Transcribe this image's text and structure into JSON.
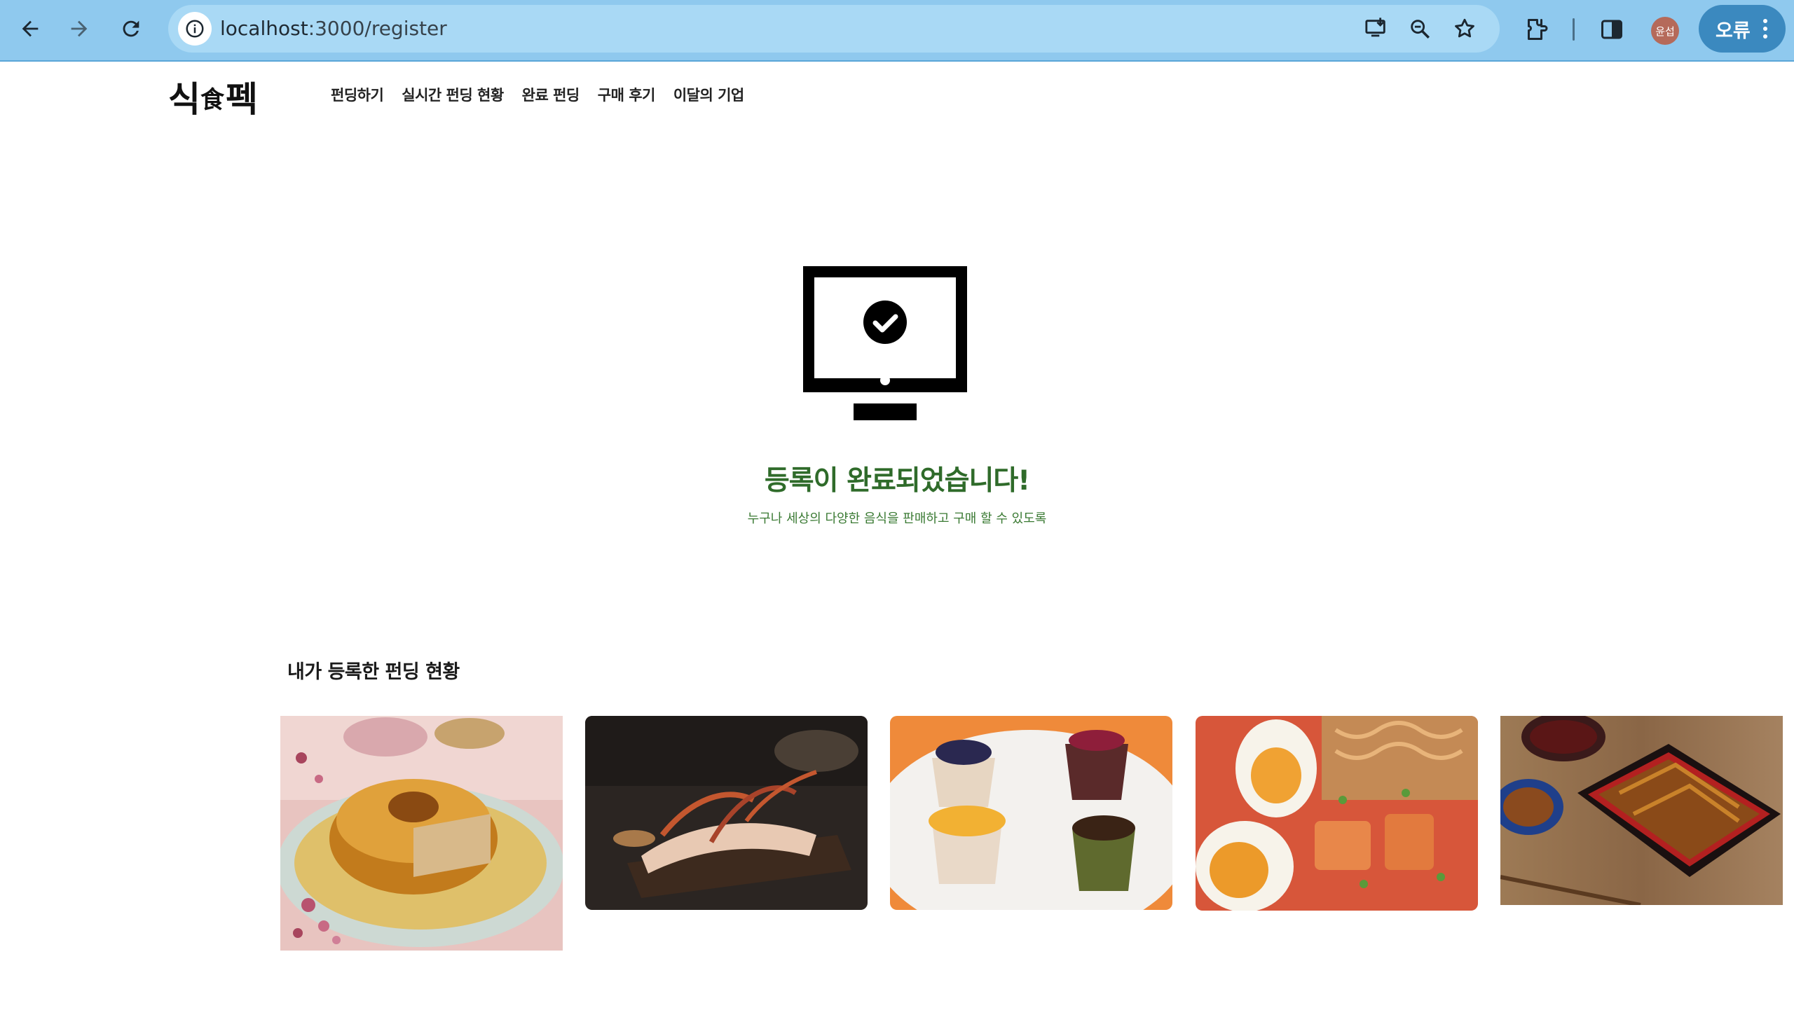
{
  "browser": {
    "url_host": "localhost",
    "url_path": ":3000/register",
    "profile_initials": "윤섭",
    "error_label": "오류",
    "icons": [
      "back-arrow-icon",
      "forward-arrow-icon",
      "reload-icon",
      "site-info-icon",
      "install-app-icon",
      "zoom-icon",
      "bookmark-star-icon",
      "extensions-icon",
      "side-panel-icon",
      "menu-dots-icon"
    ]
  },
  "site": {
    "logo_left": "식",
    "logo_mid": "食",
    "logo_right": "펙",
    "nav": [
      "펀딩하기",
      "실시간 펀딩 현황",
      "완료 펀딩",
      "구매 후기",
      "이달의 기업"
    ]
  },
  "success": {
    "title": "등록이 완료되었습니다!",
    "subtitle": "누구나 세상의 다양한 음식을 판매하고 구매 할 수 있도록",
    "accent_color": "#2f6b2a"
  },
  "funding": {
    "section_title": "내가 등록한 펀딩 현황",
    "cards": [
      {
        "image": "caramel-flan-cake-photo"
      },
      {
        "image": "grilled-squid-dish-photo"
      },
      {
        "image": "berry-panna-cotta-photo"
      },
      {
        "image": "spicy-ramen-with-egg-photo"
      },
      {
        "image": "grilled-eel-rice-box-photo"
      }
    ]
  }
}
